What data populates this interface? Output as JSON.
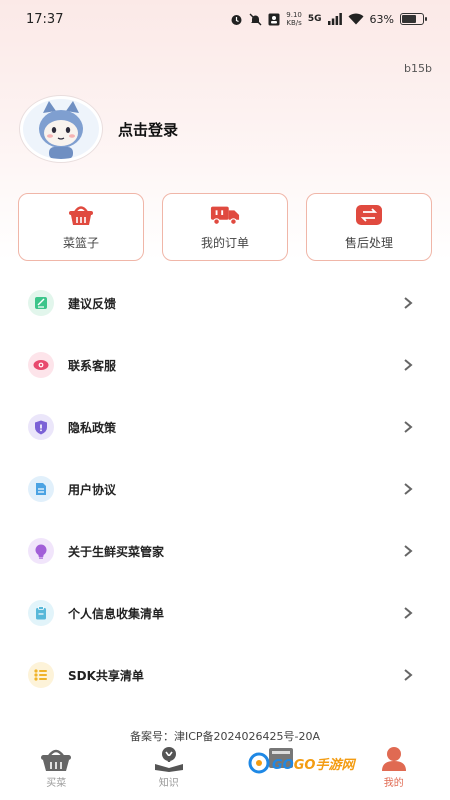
{
  "status_bar": {
    "time": "17:37",
    "net_speed_value": "9.10",
    "net_speed_unit": "KB/s",
    "signal": "5G",
    "battery": "63%"
  },
  "version": "b15b",
  "profile": {
    "login_label": "点击登录"
  },
  "quick_actions": [
    {
      "label": "菜篮子",
      "icon": "basket-icon"
    },
    {
      "label": "我的订单",
      "icon": "truck-icon"
    },
    {
      "label": "售后处理",
      "icon": "exchange-icon"
    }
  ],
  "menu": [
    {
      "label": "建议反馈",
      "icon": "feedback-icon",
      "color": "#3cc58a"
    },
    {
      "label": "联系客服",
      "icon": "eye-icon",
      "color": "#e84a6e"
    },
    {
      "label": "隐私政策",
      "icon": "shield-icon",
      "color": "#7b61d6"
    },
    {
      "label": "用户协议",
      "icon": "document-icon",
      "color": "#4ba3e3"
    },
    {
      "label": "关于生鲜买菜管家",
      "icon": "bulb-icon",
      "color": "#a25fd8"
    },
    {
      "label": "个人信息收集清单",
      "icon": "clipboard-icon",
      "color": "#57b8d9"
    },
    {
      "label": "SDK共享清单",
      "icon": "list-icon",
      "color": "#f0b32a"
    }
  ],
  "icp": "备案号：津ICP备2024026425号-20A",
  "tabs": [
    {
      "label": "买菜",
      "active": false
    },
    {
      "label": "知识",
      "active": false
    },
    {
      "label": "",
      "active": false
    },
    {
      "label": "我的",
      "active": true
    }
  ],
  "colors": {
    "accent": "#e06a52",
    "card_border": "#f0b6a8"
  },
  "watermark": {
    "text_main": "GO",
    "text_accent": "GO手游网"
  }
}
